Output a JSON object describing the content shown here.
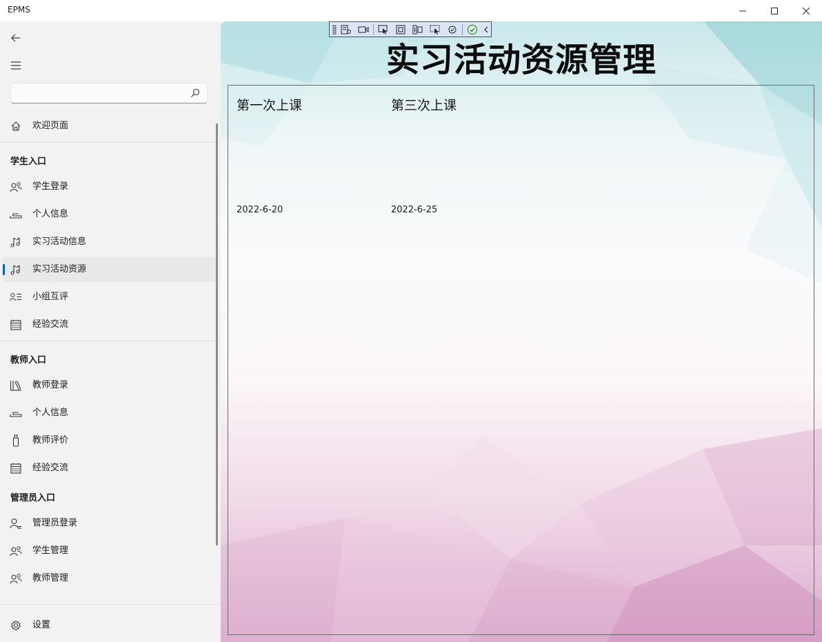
{
  "window": {
    "title": "EPMS"
  },
  "sidebar": {
    "search": {
      "value": "",
      "placeholder": ""
    },
    "welcome": "欢迎页面",
    "sections": [
      {
        "header": "学生入口",
        "items": [
          {
            "label": "学生登录",
            "icon": "people-icon"
          },
          {
            "label": "个人信息",
            "icon": "bed-icon"
          },
          {
            "label": "实习活动信息",
            "icon": "music-notes-icon"
          },
          {
            "label": "实习活动资源",
            "icon": "music-notes-icon",
            "selected": true
          },
          {
            "label": "小组互评",
            "icon": "people-list-icon"
          },
          {
            "label": "经验交流",
            "icon": "calendar-icon"
          }
        ]
      },
      {
        "header": "教师入口",
        "items": [
          {
            "label": "教师登录",
            "icon": "library-icon"
          },
          {
            "label": "个人信息",
            "icon": "bed-icon"
          },
          {
            "label": "教师评价",
            "icon": "usb-icon"
          },
          {
            "label": "经验交流",
            "icon": "calendar-icon"
          }
        ]
      },
      {
        "header": "管理员入口",
        "items": [
          {
            "label": "管理员登录",
            "icon": "contact-icon"
          },
          {
            "label": "学生管理",
            "icon": "people-icon"
          },
          {
            "label": "教师管理",
            "icon": "people-icon"
          }
        ]
      }
    ],
    "settings": "设置"
  },
  "main": {
    "title": "实习活动资源管理",
    "resources": [
      {
        "title": "第一次上课",
        "date": "2022-6-20"
      },
      {
        "title": "第三次上课",
        "date": "2022-6-25"
      }
    ]
  },
  "colors": {
    "accent": "#005fb8",
    "sidebar_bg": "#f2f2f2",
    "selected_bg": "#e9e9e9"
  }
}
